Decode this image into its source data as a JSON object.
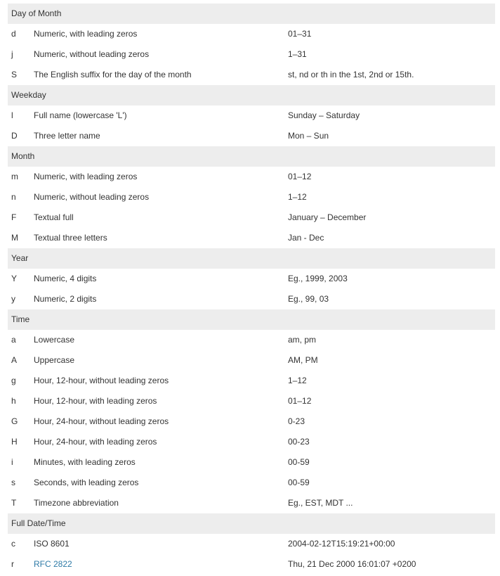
{
  "link_color": "#2f7ba7",
  "sections": [
    {
      "title": "Day of Month",
      "rows": [
        {
          "code": "d",
          "desc": "Numeric, with leading zeros",
          "example": "01–31"
        },
        {
          "code": "j",
          "desc": "Numeric, without leading zeros",
          "example": "1–31"
        },
        {
          "code": "S",
          "desc": "The English suffix for the day of the month",
          "example": "st, nd or th in the 1st, 2nd or 15th."
        }
      ]
    },
    {
      "title": "Weekday",
      "rows": [
        {
          "code": "l",
          "desc": "Full name  (lowercase 'L')",
          "example": "Sunday – Saturday"
        },
        {
          "code": "D",
          "desc": "Three letter name",
          "example": "Mon – Sun"
        }
      ]
    },
    {
      "title": "Month",
      "rows": [
        {
          "code": "m",
          "desc": "Numeric, with leading zeros",
          "example": "01–12"
        },
        {
          "code": "n",
          "desc": "Numeric, without leading zeros",
          "example": "1–12"
        },
        {
          "code": "F",
          "desc": "Textual full",
          "example": "January – December"
        },
        {
          "code": "M",
          "desc": "Textual three letters",
          "example": "Jan - Dec"
        }
      ]
    },
    {
      "title": "Year",
      "rows": [
        {
          "code": "Y",
          "desc": "Numeric, 4 digits",
          "example": "Eg., 1999, 2003"
        },
        {
          "code": "y",
          "desc": "Numeric, 2 digits",
          "example": "Eg., 99, 03"
        }
      ]
    },
    {
      "title": "Time",
      "rows": [
        {
          "code": "a",
          "desc": "Lowercase",
          "example": "am, pm"
        },
        {
          "code": "A",
          "desc": "Uppercase",
          "example": "AM, PM"
        },
        {
          "code": "g",
          "desc": "Hour, 12-hour, without leading zeros",
          "example": "1–12"
        },
        {
          "code": "h",
          "desc": "Hour, 12-hour, with leading zeros",
          "example": "01–12"
        },
        {
          "code": "G",
          "desc": "Hour, 24-hour, without leading zeros",
          "example": "0-23"
        },
        {
          "code": "H",
          "desc": "Hour, 24-hour, with leading zeros",
          "example": "00-23"
        },
        {
          "code": "i",
          "desc": "Minutes, with leading zeros",
          "example": "00-59"
        },
        {
          "code": "s",
          "desc": "Seconds, with leading zeros",
          "example": "00-59"
        },
        {
          "code": "T",
          "desc": "Timezone abbreviation",
          "example": "Eg., EST, MDT ..."
        }
      ]
    },
    {
      "title": "Full Date/Time",
      "rows": [
        {
          "code": "c",
          "desc": "ISO 8601",
          "example": "2004-02-12T15:19:21+00:00"
        },
        {
          "code": "r",
          "desc": "RFC 2822",
          "example": "Thu, 21 Dec 2000 16:01:07 +0200",
          "desc_is_link": true
        }
      ]
    }
  ]
}
